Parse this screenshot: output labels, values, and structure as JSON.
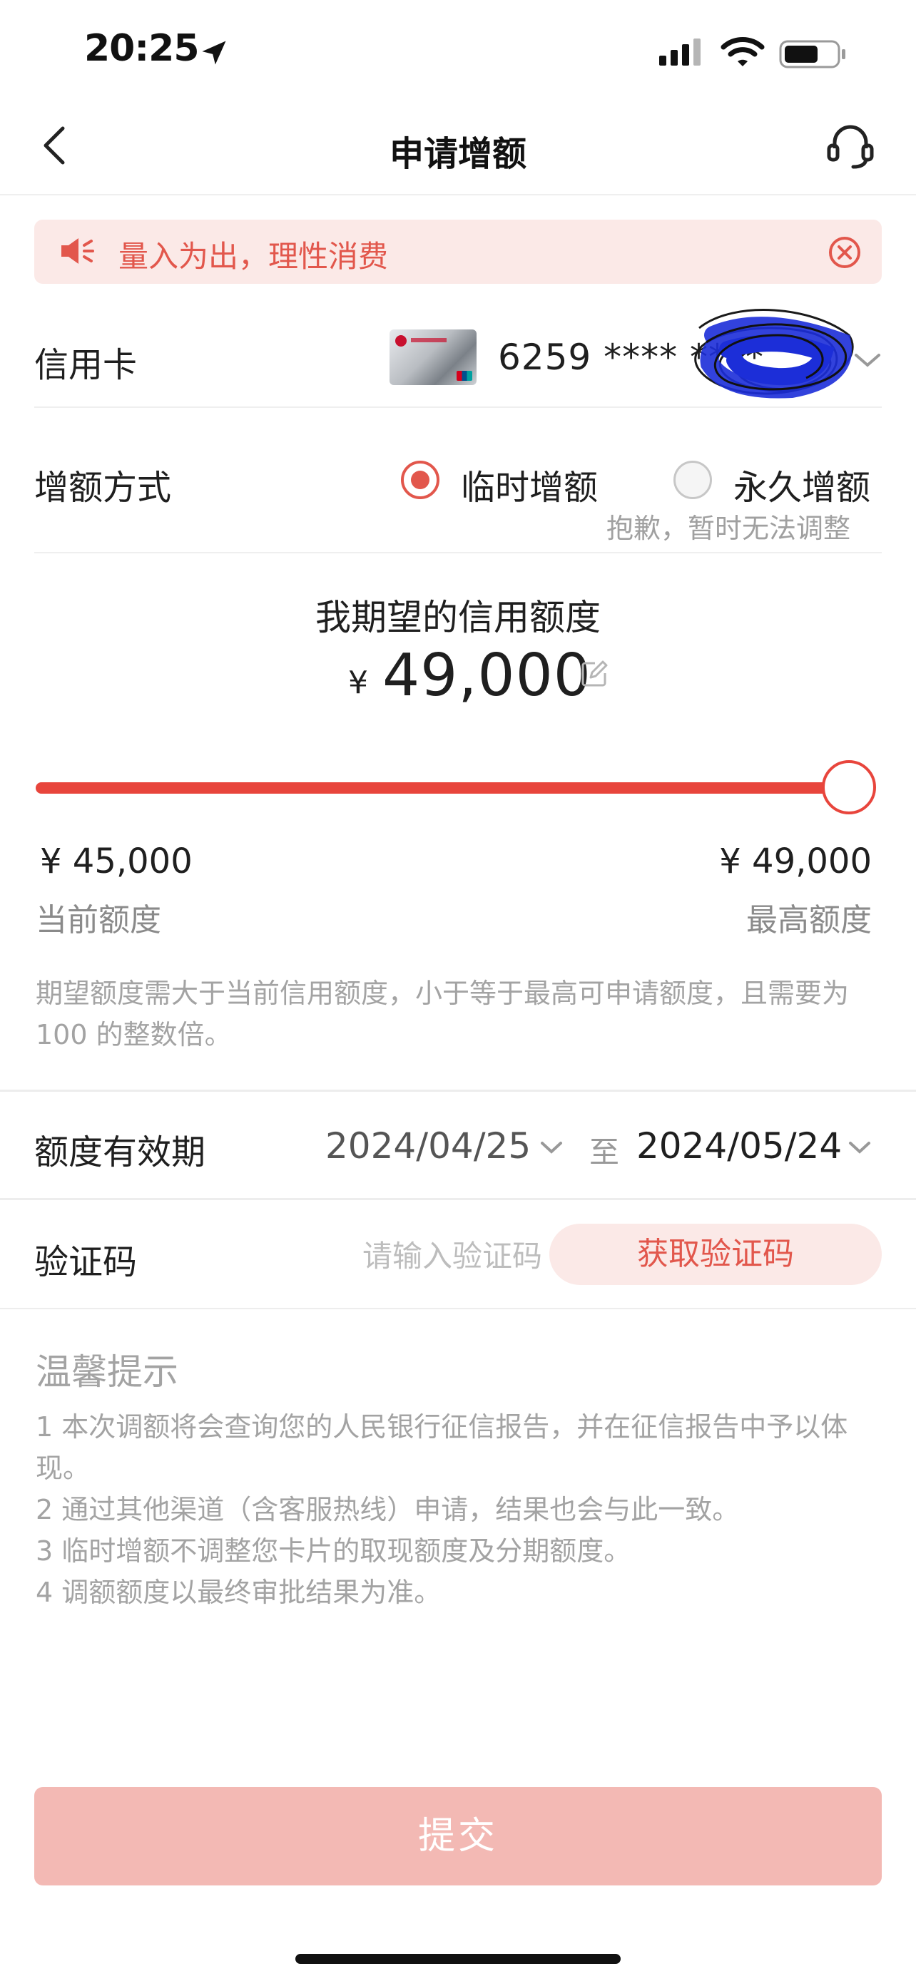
{
  "status_bar": {
    "time": "20:25",
    "icons": [
      "location-arrow-icon",
      "signal-icon",
      "wifi-icon",
      "battery-icon"
    ]
  },
  "nav": {
    "title": "申请增额",
    "icons": [
      "back-chevron-icon",
      "customer-service-icon"
    ]
  },
  "notice": {
    "text": "量入为出，理性消费",
    "icons": [
      "megaphone-icon",
      "close-circle-icon"
    ]
  },
  "card": {
    "label": "信用卡",
    "number": "6259 **** ****",
    "icons": [
      "chevron-down-icon"
    ]
  },
  "method": {
    "label": "增额方式",
    "options": [
      {
        "label": "临时增额",
        "selected": true
      },
      {
        "label": "永久增额",
        "selected": false
      }
    ],
    "permanent_note": "抱歉，暂时无法调整"
  },
  "expected": {
    "label": "我期望的信用额度",
    "currency": "¥",
    "amount": "49,000",
    "icons": [
      "edit-icon"
    ]
  },
  "slider": {
    "min": 45000,
    "max": 49000,
    "value": 49000,
    "min_text": "¥  45,000",
    "max_text": "¥  49,000",
    "min_label": "当前额度",
    "max_label": "最高额度",
    "hint": "期望额度需大于当前信用额度，小于等于最高可申请额度，且需要为 100 的整数倍。"
  },
  "validity": {
    "label": "额度有效期",
    "start": "2024/04/25",
    "to": "至",
    "end": "2024/05/24"
  },
  "verification": {
    "label": "验证码",
    "placeholder": "请输入验证码",
    "value": "",
    "button": "获取验证码"
  },
  "tips": {
    "title": "温馨提示",
    "items": [
      "1  本次调额将会查询您的人民银行征信报告，并在征信报告中予以体现。",
      "2  通过其他渠道（含客服热线）申请，结果也会与此一致。",
      "3  临时增额不调整您卡片的取现额度及分期额度。",
      "4  调额额度以最终审批结果为准。"
    ]
  },
  "submit": {
    "label": "提交"
  },
  "colors": {
    "accent": "#e8453c",
    "notice_bg": "#fbe9e7",
    "submit_disabled": "#f3b9b4"
  }
}
